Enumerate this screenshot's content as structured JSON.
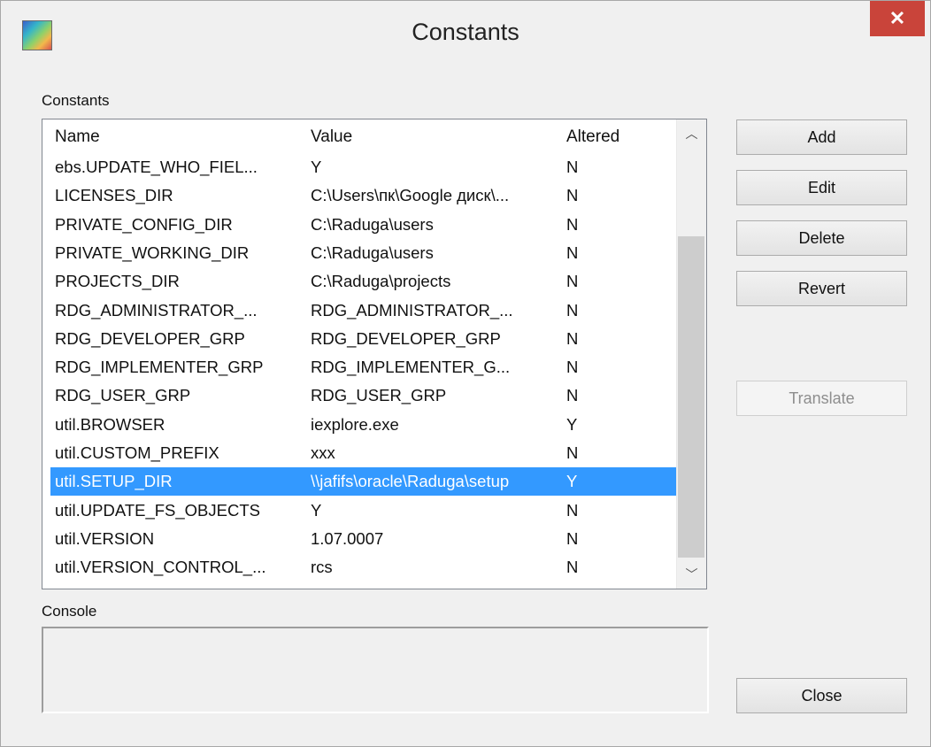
{
  "window": {
    "title": "Constants",
    "close_glyph": "✕"
  },
  "constants_group": {
    "label": "Constants"
  },
  "table": {
    "columns": [
      "Name",
      "Value",
      "Altered"
    ],
    "rows": [
      {
        "name": "ebs.UPDATE_WHO_FIEL...",
        "value": "Y",
        "altered": "N"
      },
      {
        "name": "LICENSES_DIR",
        "value": "C:\\Users\\пк\\Google диск\\...",
        "altered": "N"
      },
      {
        "name": "PRIVATE_CONFIG_DIR",
        "value": "C:\\Raduga\\users",
        "altered": "N"
      },
      {
        "name": "PRIVATE_WORKING_DIR",
        "value": "C:\\Raduga\\users",
        "altered": "N"
      },
      {
        "name": "PROJECTS_DIR",
        "value": "C:\\Raduga\\projects",
        "altered": "N"
      },
      {
        "name": "RDG_ADMINISTRATOR_...",
        "value": "RDG_ADMINISTRATOR_...",
        "altered": "N"
      },
      {
        "name": "RDG_DEVELOPER_GRP",
        "value": "RDG_DEVELOPER_GRP",
        "altered": "N"
      },
      {
        "name": "RDG_IMPLEMENTER_GRP",
        "value": "RDG_IMPLEMENTER_G...",
        "altered": "N"
      },
      {
        "name": "RDG_USER_GRP",
        "value": "RDG_USER_GRP",
        "altered": "N"
      },
      {
        "name": "util.BROWSER",
        "value": "iexplore.exe",
        "altered": "Y"
      },
      {
        "name": "util.CUSTOM_PREFIX",
        "value": "xxx",
        "altered": "N"
      },
      {
        "name": "util.SETUP_DIR",
        "value": "\\\\jafifs\\oracle\\Raduga\\setup",
        "altered": "Y"
      },
      {
        "name": "util.UPDATE_FS_OBJECTS",
        "value": "Y",
        "altered": "N"
      },
      {
        "name": "util.VERSION",
        "value": "1.07.0007",
        "altered": "N"
      },
      {
        "name": "util.VERSION_CONTROL_...",
        "value": "rcs",
        "altered": "N"
      }
    ],
    "selected_row": "util.SETUP_DIR"
  },
  "console_group": {
    "label": "Console",
    "text": ""
  },
  "buttons": {
    "add": "Add",
    "edit": "Edit",
    "delete": "Delete",
    "revert": "Revert",
    "translate": "Translate",
    "close": "Close"
  },
  "scrollbar": {
    "up_glyph": "︿",
    "down_glyph": "﹀"
  }
}
